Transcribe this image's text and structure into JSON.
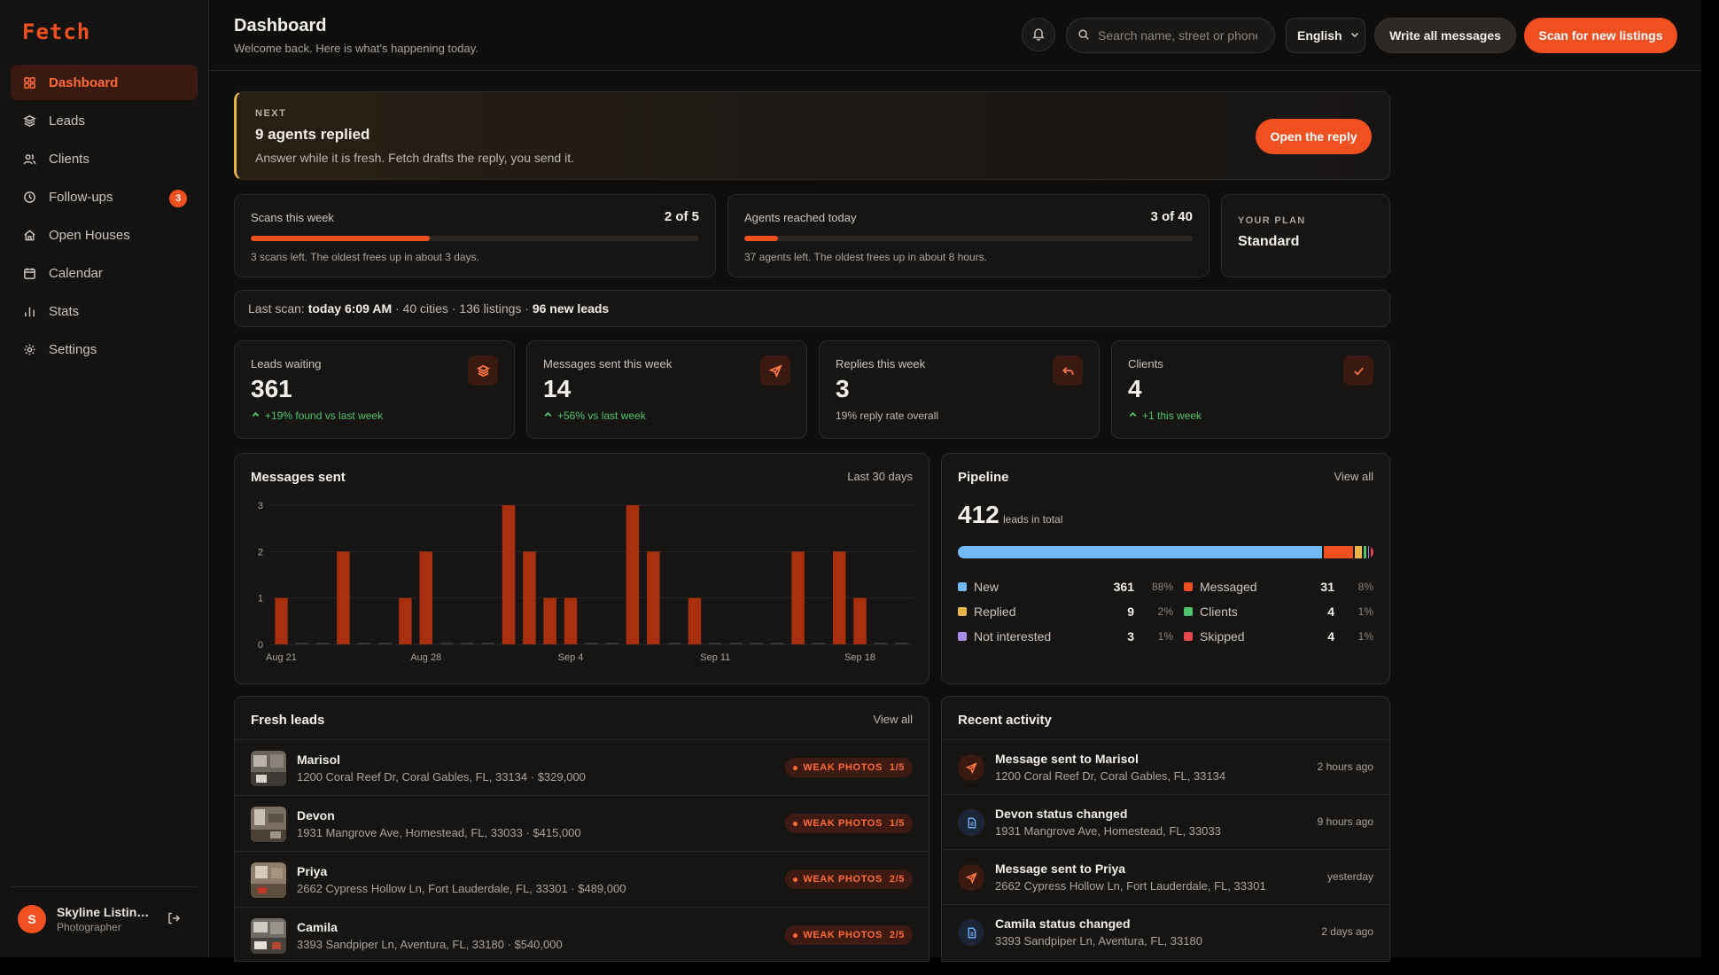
{
  "app": {
    "logo": "Fetch"
  },
  "colors": {
    "accent": "#f0501f",
    "background": "#0f0e0d",
    "card": "#171514",
    "positive": "#4fc46b"
  },
  "sidebar": {
    "items": [
      {
        "label": "Dashboard",
        "icon": "grid-icon",
        "active": true
      },
      {
        "label": "Leads",
        "icon": "layers-icon"
      },
      {
        "label": "Clients",
        "icon": "users-icon"
      },
      {
        "label": "Follow-ups",
        "icon": "clock-icon",
        "badge": "3"
      },
      {
        "label": "Open Houses",
        "icon": "home-icon"
      },
      {
        "label": "Calendar",
        "icon": "calendar-icon"
      },
      {
        "label": "Stats",
        "icon": "bar-chart-icon"
      },
      {
        "label": "Settings",
        "icon": "gear-icon"
      }
    ],
    "user": {
      "initial": "S",
      "name": "Skyline Listing...",
      "role": "Photographer"
    }
  },
  "header": {
    "title": "Dashboard",
    "subtitle": "Welcome back. Here is what's happening today.",
    "search_placeholder": "Search name, street or phone",
    "language": "English",
    "write_all": "Write all messages",
    "scan": "Scan for new listings"
  },
  "next": {
    "label": "NEXT",
    "title": "9 agents replied",
    "desc": "Answer while it is fresh. Fetch drafts the reply, you send it.",
    "button": "Open the reply"
  },
  "quotas": [
    {
      "title": "Scans this week",
      "value": "2 of 5",
      "progress": 0.4,
      "note": "3 scans left. The oldest frees up in about 3 days."
    },
    {
      "title": "Agents reached today",
      "value": "3 of 40",
      "progress": 0.075,
      "note": "37 agents left. The oldest frees up in about 8 hours."
    }
  ],
  "plan": {
    "label": "YOUR PLAN",
    "value": "Standard"
  },
  "last_scan": {
    "prefix": "Last scan:",
    "time": "today 6:09 AM",
    "middle": "· 40 cities · 136 listings ·",
    "leads": "96 new leads"
  },
  "stats": [
    {
      "title": "Leads waiting",
      "value": "361",
      "sub": "+19% found vs last week",
      "trend": "up",
      "icon": "layers-icon"
    },
    {
      "title": "Messages sent this week",
      "value": "14",
      "sub": "+56% vs last week",
      "trend": "up",
      "icon": "send-icon"
    },
    {
      "title": "Replies this week",
      "value": "3",
      "sub": "19% reply rate overall",
      "trend": "none",
      "icon": "reply-icon"
    },
    {
      "title": "Clients",
      "value": "4",
      "sub": "+1 this week",
      "trend": "up",
      "icon": "check-icon"
    }
  ],
  "messages_chart": {
    "title": "Messages sent",
    "range": "Last 30 days"
  },
  "chart_data": {
    "type": "bar",
    "title": "Messages sent",
    "xlabel": "",
    "ylabel": "",
    "ylim": [
      0,
      3
    ],
    "yticks": [
      0,
      1,
      2,
      3
    ],
    "x": [
      "Aug 21",
      "Aug 22",
      "Aug 23",
      "Aug 24",
      "Aug 25",
      "Aug 26",
      "Aug 27",
      "Aug 28",
      "Aug 29",
      "Aug 30",
      "Aug 31",
      "Sep 1",
      "Sep 2",
      "Sep 3",
      "Sep 4",
      "Sep 5",
      "Sep 6",
      "Sep 7",
      "Sep 8",
      "Sep 9",
      "Sep 10",
      "Sep 11",
      "Sep 12",
      "Sep 13",
      "Sep 14",
      "Sep 15",
      "Sep 16",
      "Sep 17",
      "Sep 18",
      "Sep 19",
      "Sep 20"
    ],
    "values": [
      1,
      0,
      0,
      2,
      0,
      0,
      1,
      2,
      0,
      0,
      0,
      3,
      2,
      1,
      1,
      0,
      0,
      3,
      2,
      0,
      1,
      0,
      0,
      0,
      0,
      2,
      0,
      2,
      1,
      0,
      0
    ],
    "xtick_labels": [
      "Aug 21",
      "Aug 28",
      "Sep 4",
      "Sep 11",
      "Sep 18"
    ],
    "grid": true,
    "color": "#a8300f"
  },
  "pipeline": {
    "title": "Pipeline",
    "link": "View all",
    "total": "412",
    "total_label": "leads in total",
    "segments": [
      {
        "name": "New",
        "count": "361",
        "pct": "88%",
        "value": 361,
        "color": "#72b8f2"
      },
      {
        "name": "Messaged",
        "count": "31",
        "pct": "8%",
        "value": 31,
        "color": "#f0501f"
      },
      {
        "name": "Replied",
        "count": "9",
        "pct": "2%",
        "value": 9,
        "color": "#e8b347"
      },
      {
        "name": "Clients",
        "count": "4",
        "pct": "1%",
        "value": 4,
        "color": "#4fc46b"
      },
      {
        "name": "Not interested",
        "count": "3",
        "pct": "1%",
        "value": 3,
        "color": "#a88be8"
      },
      {
        "name": "Skipped",
        "count": "4",
        "pct": "1%",
        "value": 4,
        "color": "#e5484d"
      }
    ]
  },
  "fresh_leads": {
    "title": "Fresh leads",
    "link": "View all",
    "rows": [
      {
        "name": "Marisol",
        "address": "1200 Coral Reef Dr, Coral Gables, FL, 33134 · $329,000",
        "tag": "WEAK PHOTOS",
        "score": "1/5"
      },
      {
        "name": "Devon",
        "address": "1931 Mangrove Ave, Homestead, FL, 33033 · $415,000",
        "tag": "WEAK PHOTOS",
        "score": "1/5"
      },
      {
        "name": "Priya",
        "address": "2662 Cypress Hollow Ln, Fort Lauderdale, FL, 33301 · $489,000",
        "tag": "WEAK PHOTOS",
        "score": "2/5"
      },
      {
        "name": "Camila",
        "address": "3393 Sandpiper Ln, Aventura, FL, 33180 · $540,000",
        "tag": "WEAK PHOTOS",
        "score": "2/5"
      }
    ]
  },
  "activity": {
    "title": "Recent activity",
    "rows": [
      {
        "title": "Message sent to Marisol",
        "address": "1200 Coral Reef Dr, Coral Gables, FL, 33134",
        "when": "2 hours ago",
        "icon": "send-icon"
      },
      {
        "title": "Devon status changed",
        "address": "1931 Mangrove Ave, Homestead, FL, 33033",
        "when": "9 hours ago",
        "icon": "document-icon"
      },
      {
        "title": "Message sent to Priya",
        "address": "2662 Cypress Hollow Ln, Fort Lauderdale, FL, 33301",
        "when": "yesterday",
        "icon": "send-icon"
      },
      {
        "title": "Camila status changed",
        "address": "3393 Sandpiper Ln, Aventura, FL, 33180",
        "when": "2 days ago",
        "icon": "document-icon"
      }
    ]
  }
}
